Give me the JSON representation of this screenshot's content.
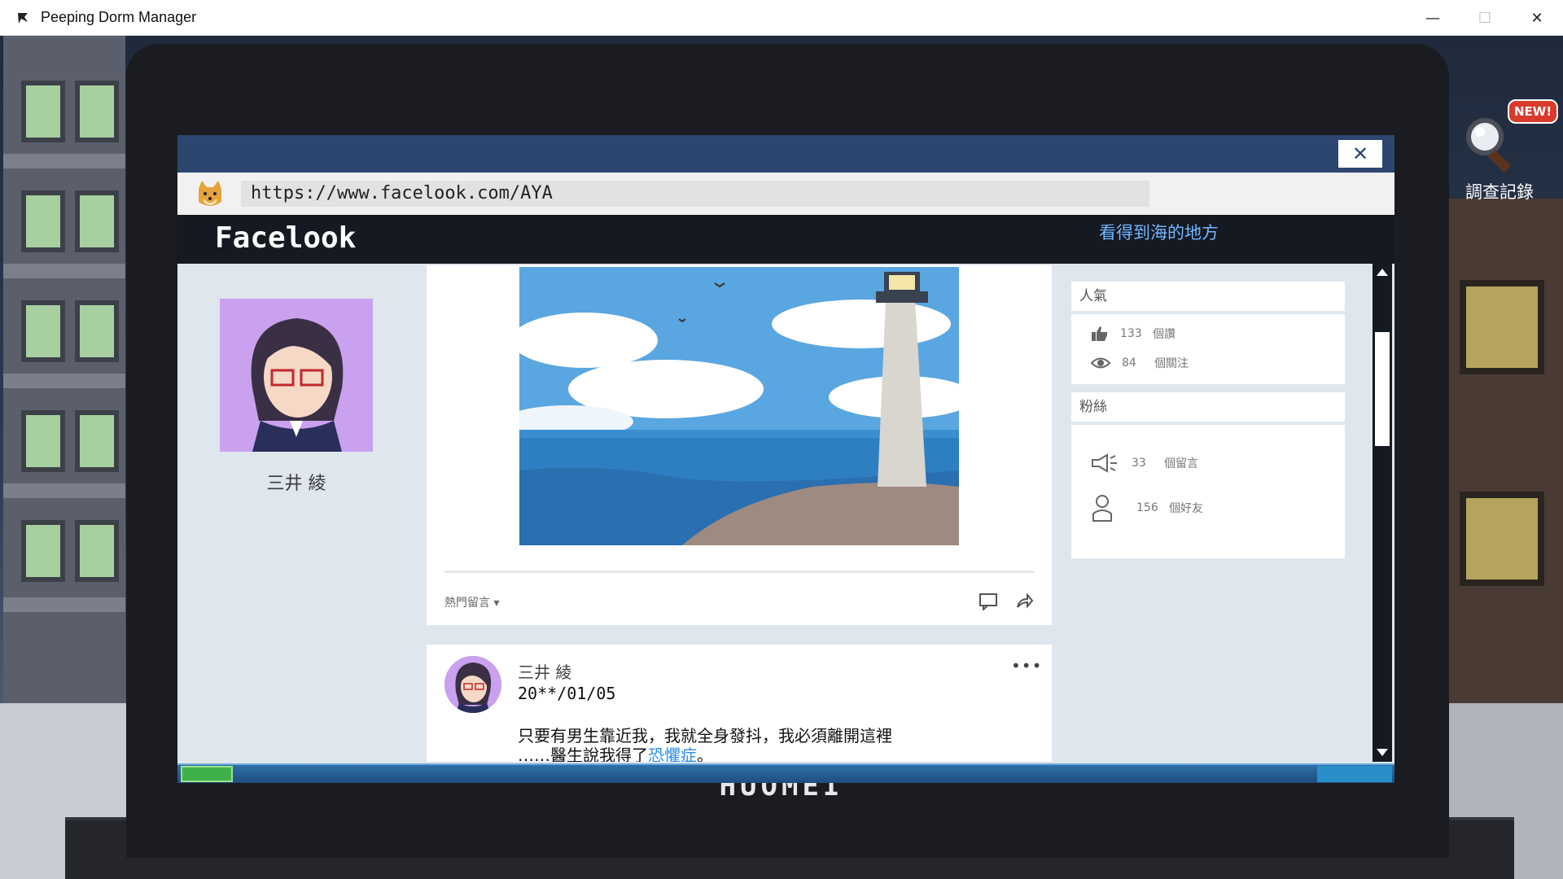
{
  "window": {
    "title": "Peeping Dorm Manager",
    "controls": {
      "minimize": "—",
      "maximize": "☐",
      "close": "✕"
    }
  },
  "investigate": {
    "badge": "NEW!",
    "label": "調查記錄",
    "icon": "magnifier-icon"
  },
  "browser": {
    "close_label": "✕",
    "url": "https://www.facelook.com/AYA"
  },
  "site": {
    "logo": "Facelook",
    "subtitle": "看得到海的地方"
  },
  "profile": {
    "name": "三井 綾"
  },
  "post": {
    "hot_comments_label": "熱門留言 ▾",
    "icons": [
      "comment-icon",
      "share-icon"
    ]
  },
  "comment": {
    "author": "三井 綾",
    "date": "20**/01/05",
    "more": "•••",
    "text_line1": "只要有男生靠近我，我就全身發抖，我必須離開這裡",
    "text_line2_prefix": "……醫生說我得了",
    "text_line2_highlight": "恐懼症",
    "text_line2_suffix": "。"
  },
  "popularity": {
    "header": "人氣",
    "likes_count": "133",
    "likes_label": "個讚",
    "follows_count": "84",
    "follows_label": "個關注"
  },
  "fans": {
    "header": "粉絲",
    "comments_count": "33",
    "comments_label": "個留言",
    "friends_count": "156",
    "friends_label": "個好友"
  },
  "laptop": {
    "brand": "HUOMEI"
  },
  "colors": {
    "browser_top": "#2c4670",
    "header_bg": "#151922",
    "subtitle": "#6fb7ff",
    "highlight": "#2f8ee8",
    "badge": "#d93a2c"
  }
}
